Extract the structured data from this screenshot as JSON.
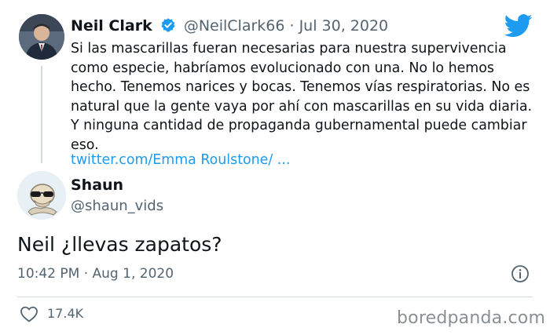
{
  "quoted_tweet": {
    "name": "Neil Clark",
    "handle_date": "@NeilClark66 · Jul 30, 2020",
    "text": "Si las mascarillas fueran necesarias para nuestra supervivencia como especie, habríamos evolucionado con una. No lo hemos hecho. Tenemos narices y bocas. Tenemos vías respiratorias. No es natural que la gente vaya por ahí con mascarillas en su vida diaria. Y ninguna cantidad de propaganda gubernamental puede cambiar eso.",
    "link": "twitter.com/Emma Roulstone/ ...",
    "verified": true
  },
  "reply": {
    "name": "Shaun",
    "handle": "@shaun_vids",
    "text": "Neil ¿llevas zapatos?",
    "timestamp": "10:42 PM · Aug 1, 2020",
    "likes": "17.4K"
  },
  "watermark": "boredpanda.com",
  "icons": {
    "brand": "twitter-bird-icon",
    "verified": "verified-badge-icon",
    "info": "info-icon",
    "like": "heart-icon"
  },
  "colors": {
    "twitter_blue": "#1d9bf0",
    "secondary_text": "#536471",
    "divider": "#cfd9de"
  }
}
